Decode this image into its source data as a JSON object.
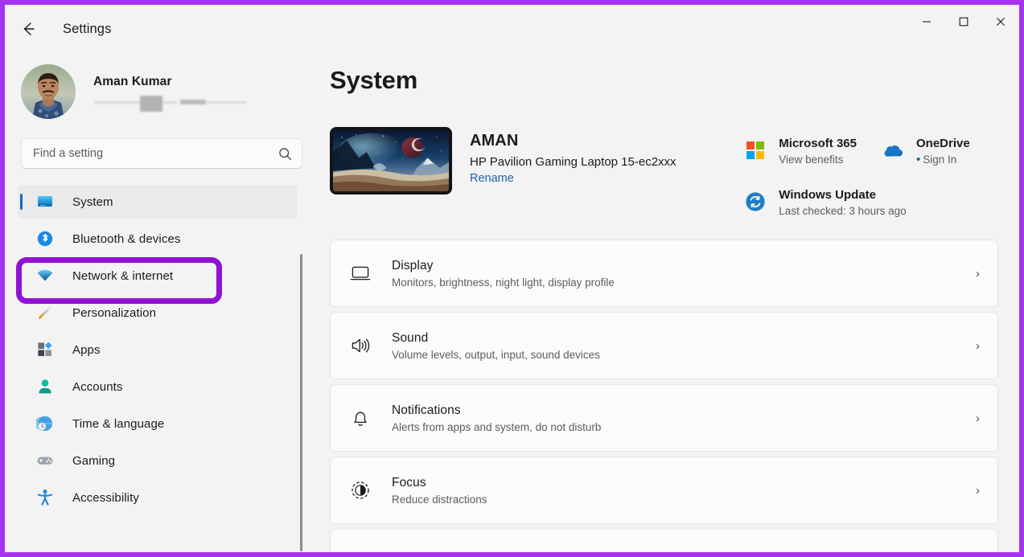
{
  "window": {
    "title": "Settings",
    "back_icon": "back-arrow-icon",
    "minimize_label": "—",
    "maximize_label": "□",
    "close_label": "✕"
  },
  "accent_colors": {
    "annotation_purple": "#9013d3",
    "frame_purple": "#a533ef",
    "selection_blue": "#0a6ebd",
    "link_blue": "#1a5fa8"
  },
  "profile": {
    "name": "Aman Kumar",
    "email_redacted": true,
    "avatar_icon": "user-avatar"
  },
  "search": {
    "placeholder": "Find a setting",
    "value": "",
    "icon": "search-icon"
  },
  "sidebar": {
    "items": [
      {
        "label": "System",
        "icon": "system-monitor-icon",
        "selected": true,
        "highlighted": false
      },
      {
        "label": "Bluetooth & devices",
        "icon": "bluetooth-icon",
        "selected": false,
        "highlighted": false
      },
      {
        "label": "Network & internet",
        "icon": "wifi-icon",
        "selected": false,
        "highlighted": true
      },
      {
        "label": "Personalization",
        "icon": "paintbrush-icon",
        "selected": false,
        "highlighted": false
      },
      {
        "label": "Apps",
        "icon": "apps-grid-icon",
        "selected": false,
        "highlighted": false
      },
      {
        "label": "Accounts",
        "icon": "person-icon",
        "selected": false,
        "highlighted": false
      },
      {
        "label": "Time & language",
        "icon": "globe-clock-icon",
        "selected": false,
        "highlighted": false
      },
      {
        "label": "Gaming",
        "icon": "gamepad-icon",
        "selected": false,
        "highlighted": false
      },
      {
        "label": "Accessibility",
        "icon": "accessibility-icon",
        "selected": false,
        "highlighted": false
      }
    ]
  },
  "main": {
    "page_title": "System",
    "device": {
      "name": "AMAN",
      "model": "HP Pavilion Gaming Laptop 15-ec2xxx",
      "rename_label": "Rename",
      "thumbnail_icon": "desktop-wallpaper-thumbnail"
    },
    "status_tiles": [
      {
        "title": "Microsoft 365",
        "subtitle": "View benefits",
        "icon": "microsoft-logo-icon",
        "has_dot": false
      },
      {
        "title": "OneDrive",
        "subtitle": "Sign In",
        "icon": "onedrive-cloud-icon",
        "has_dot": true
      },
      {
        "title": "Windows Update",
        "subtitle": "Last checked: 3 hours ago",
        "icon": "windows-update-sync-icon",
        "has_dot": false
      }
    ],
    "cards": [
      {
        "title": "Display",
        "subtitle": "Monitors, brightness, night light, display profile",
        "icon": "display-monitor-icon",
        "chevron": "›"
      },
      {
        "title": "Sound",
        "subtitle": "Volume levels, output, input, sound devices",
        "icon": "speaker-icon",
        "chevron": "›"
      },
      {
        "title": "Notifications",
        "subtitle": "Alerts from apps and system, do not disturb",
        "icon": "bell-icon",
        "chevron": "›"
      },
      {
        "title": "Focus",
        "subtitle": "Reduce distractions",
        "icon": "focus-moon-icon",
        "chevron": "›"
      }
    ]
  }
}
